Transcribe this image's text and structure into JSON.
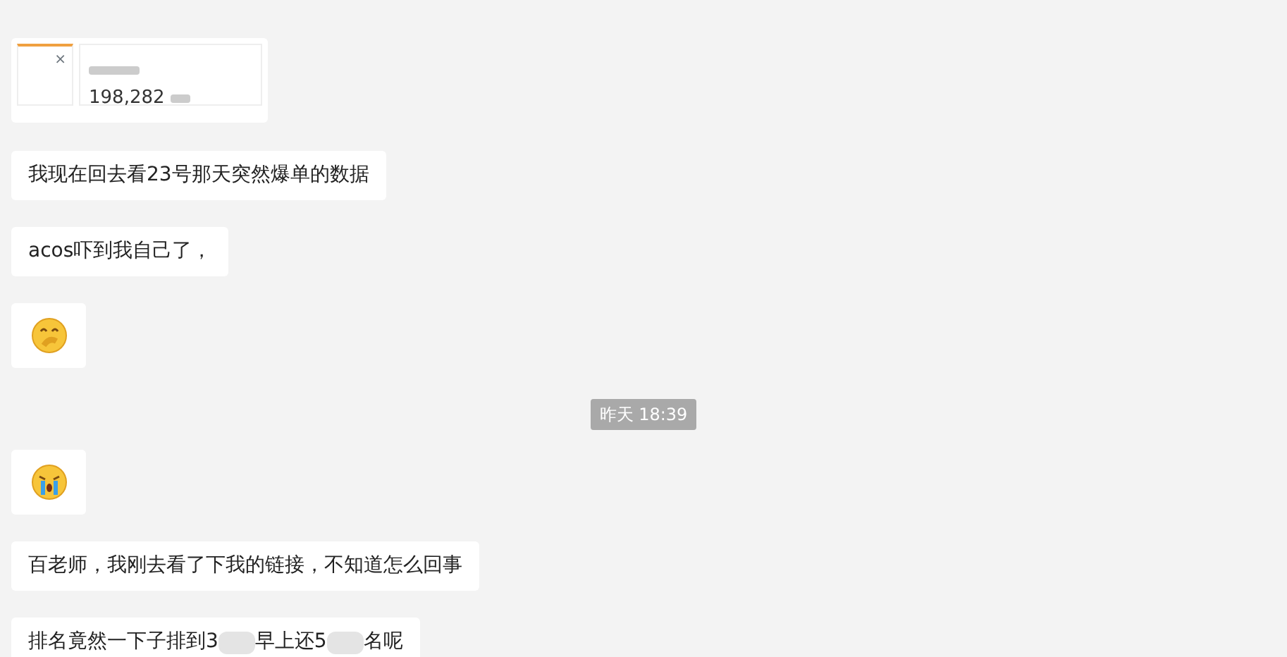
{
  "messages": [
    {
      "kind": "screenshot",
      "close": "×",
      "value": "198,282"
    },
    {
      "kind": "text",
      "parts": [
        {
          "kind": "text",
          "text": "我现在回去看23号那天突然爆单的数据"
        }
      ]
    },
    {
      "kind": "text",
      "parts": [
        {
          "kind": "text",
          "text": "acos吓到我自己了，"
        }
      ]
    },
    {
      "kind": "emoji",
      "icon": {
        "kind": "smirk"
      }
    },
    {
      "kind": "time",
      "text": "昨天 18:39"
    },
    {
      "kind": "emoji",
      "icon": {
        "kind": "cry"
      }
    },
    {
      "kind": "text",
      "parts": [
        {
          "kind": "text",
          "text": "百老师，我刚去看了下我的链接，不知道怎么回事"
        }
      ]
    },
    {
      "kind": "text",
      "parts": [
        {
          "kind": "text",
          "text": "排名竟然一下子排到3"
        },
        {
          "kind": "redacted"
        },
        {
          "kind": "text",
          "text": "早上还5"
        },
        {
          "kind": "redacted"
        },
        {
          "kind": "text",
          "text": "名呢"
        }
      ]
    }
  ]
}
